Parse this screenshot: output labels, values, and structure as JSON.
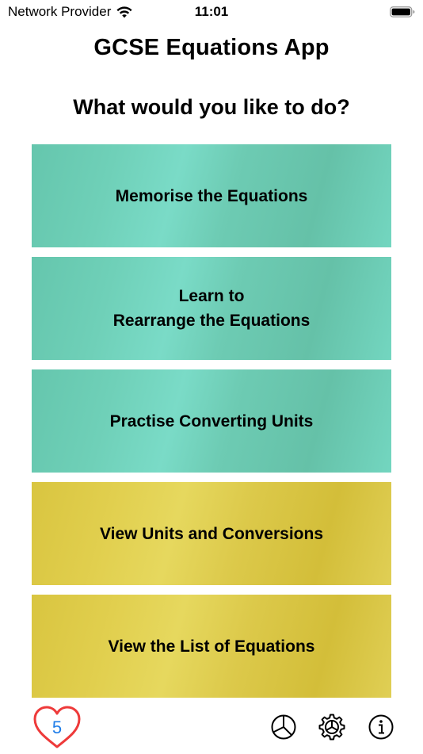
{
  "status_bar": {
    "carrier": "Network Provider",
    "time": "11:01"
  },
  "header": {
    "title": "GCSE Equations App",
    "subtitle": "What would you like to do?"
  },
  "menu": {
    "items": [
      {
        "label": "Memorise the Equations",
        "color": "#6fd0b8"
      },
      {
        "label": "Learn to\nRearrange the Equations",
        "color": "#6fd0b8"
      },
      {
        "label": "Practise Converting Units",
        "color": "#6fd0b8"
      },
      {
        "label": "View Units and Conversions",
        "color": "#e1cf4e"
      },
      {
        "label": "View the List of Equations",
        "color": "#e1cf4e"
      }
    ]
  },
  "bottom_bar": {
    "likes_count": "5",
    "icons": [
      "heart-icon",
      "pie-chart-icon",
      "settings-gear-icon",
      "info-icon"
    ],
    "heart_color": "#ee3a3a",
    "count_color": "#1f7de8"
  }
}
